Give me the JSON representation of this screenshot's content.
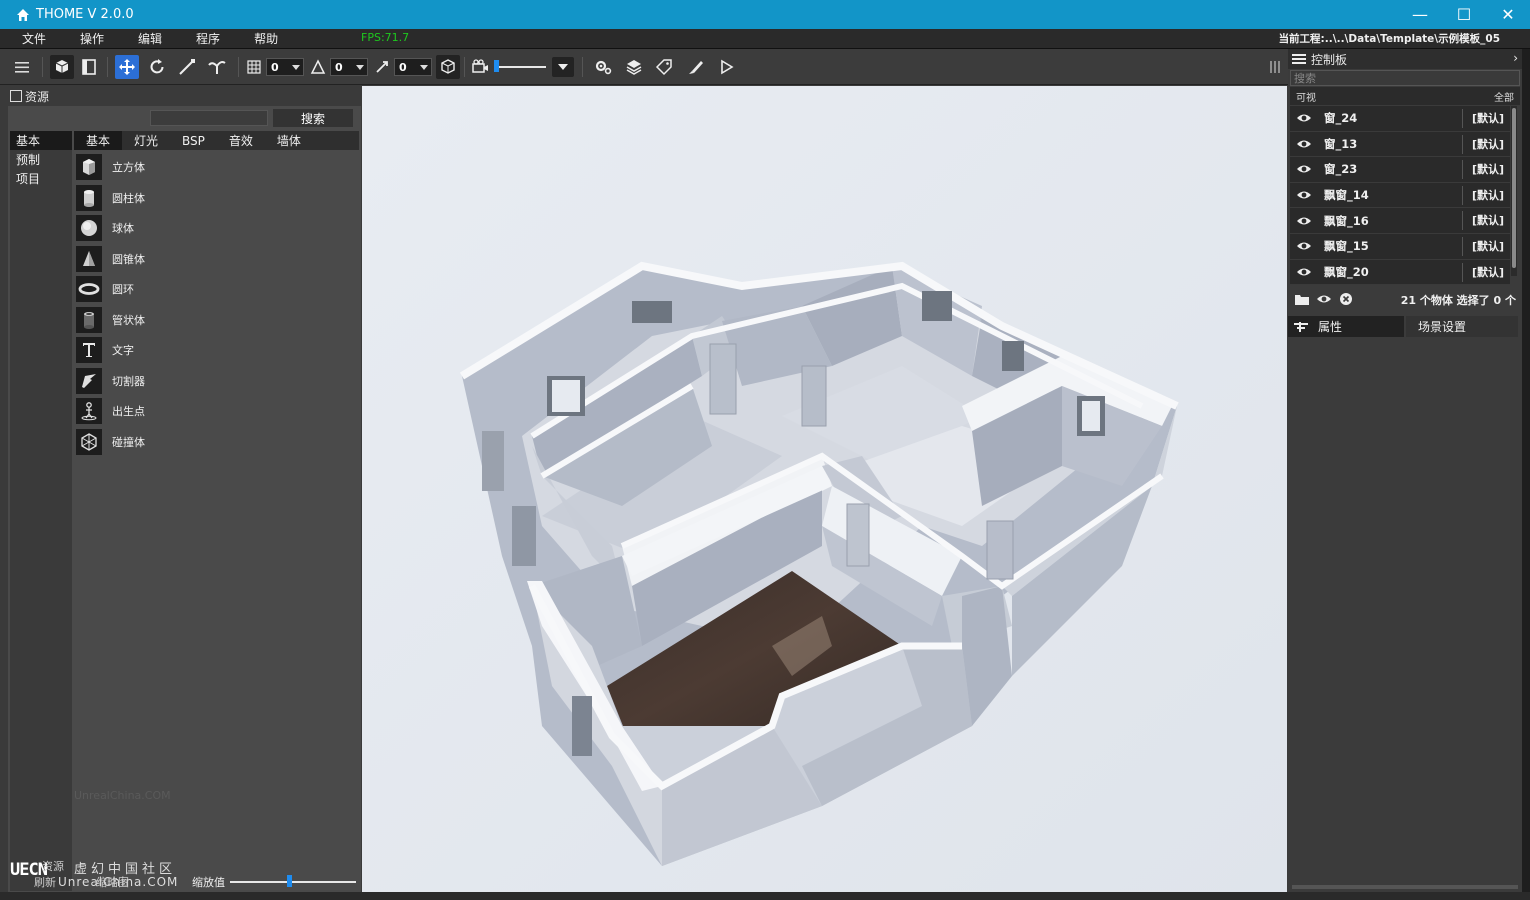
{
  "window": {
    "title": "THOME  V 2.0.0",
    "minimize": "—",
    "maximize": "☐",
    "close": "✕"
  },
  "menu": {
    "items": [
      "文件",
      "操作",
      "编辑",
      "程序",
      "帮助"
    ],
    "fps": "FPS:71.7",
    "project_path": "当前工程:..\\..\\Data\\Template\\示例模板_05"
  },
  "toolbar": {
    "grid_value": "0",
    "angle_value": "0",
    "scale_value": "0"
  },
  "resources": {
    "header": "资源",
    "search_button": "搜索",
    "categories": [
      "基本",
      "预制",
      "项目"
    ],
    "tabs": [
      "基本",
      "灯光",
      "BSP",
      "音效",
      "墙体"
    ],
    "assets": [
      {
        "label": "立方体",
        "icon": "cube-icon"
      },
      {
        "label": "圆柱体",
        "icon": "cylinder-icon"
      },
      {
        "label": "球体",
        "icon": "sphere-icon"
      },
      {
        "label": "圆锥体",
        "icon": "cone-icon"
      },
      {
        "label": "圆环",
        "icon": "torus-icon"
      },
      {
        "label": "管状体",
        "icon": "tube-icon"
      },
      {
        "label": "文字",
        "icon": "text-icon"
      },
      {
        "label": "切割器",
        "icon": "cutter-icon"
      },
      {
        "label": "出生点",
        "icon": "spawn-point-icon"
      },
      {
        "label": "碰撞体",
        "icon": "collider-icon"
      }
    ],
    "zoom_label": "缩放值",
    "footer_resource": "资源",
    "footer_refresh": "刷新",
    "footer_thumb": "缩略图"
  },
  "watermark": {
    "logo": "UECN",
    "cn": "虚幻中国社区",
    "en": "UnrealChina.COM",
    "faint": "UnrealChina.COM"
  },
  "control_panel": {
    "header": "控制板",
    "search_placeholder": "搜索",
    "col_visible": "可视",
    "col_all": "全部",
    "objects": [
      {
        "name": "窗_24",
        "tag": "[默认]"
      },
      {
        "name": "窗_13",
        "tag": "[默认]"
      },
      {
        "name": "窗_23",
        "tag": "[默认]"
      },
      {
        "name": "飘窗_14",
        "tag": "[默认]"
      },
      {
        "name": "飘窗_16",
        "tag": "[默认]"
      },
      {
        "name": "飘窗_15",
        "tag": "[默认]"
      },
      {
        "name": "飘窗_20",
        "tag": "[默认]"
      }
    ],
    "count_text": "21 个物体  选择了 0 个",
    "tab_properties": "属性",
    "tab_scene": "场景设置"
  },
  "colors": {
    "titlebar": "#1295c8",
    "accent": "#2c6fd6",
    "fps": "#1ec81e"
  }
}
